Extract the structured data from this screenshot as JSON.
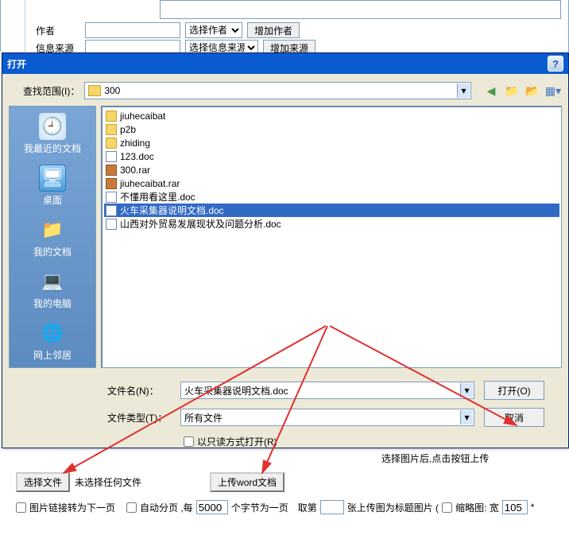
{
  "top_form": {
    "author_label": "作者",
    "author_select": "选择作者",
    "add_author_btn": "增加作者",
    "source_label": "信息来源",
    "source_select": "选择信息来源",
    "add_source_btn": "增加来源"
  },
  "dialog": {
    "title": "打开",
    "lookin_label": "查找范围(I)：",
    "lookin_value": "300",
    "sidebar": {
      "recent": "我最近的文档",
      "desktop": "桌面",
      "mydocs": "我的文档",
      "computer": "我的电脑",
      "network": "网上邻居"
    },
    "files": [
      {
        "type": "folder",
        "name": "jiuhecaibat"
      },
      {
        "type": "folder",
        "name": "p2b"
      },
      {
        "type": "folder",
        "name": "zhiding"
      },
      {
        "type": "doc",
        "name": "123.doc"
      },
      {
        "type": "rar",
        "name": "300.rar"
      },
      {
        "type": "rar",
        "name": "jiuhecaibat.rar"
      },
      {
        "type": "doc",
        "name": "不懂用看这里.doc"
      },
      {
        "type": "doc",
        "name": "火车采集器说明文档.doc",
        "selected": true
      },
      {
        "type": "doc",
        "name": "山西对外贸易发展现状及问题分析.doc"
      }
    ],
    "filename_label": "文件名(N)：",
    "filename_value": "火车采集器说明文档.doc",
    "filetype_label": "文件类型(T)：",
    "filetype_value": "所有文件",
    "open_btn": "打开(O)",
    "cancel_btn": "取消",
    "readonly_label": "以只读方式打开(R)"
  },
  "bottom": {
    "hint": "选择图片后,点击按钮上传",
    "choose_file_btn": "选择文件",
    "no_file_text": "未选择任何文件",
    "upload_word_btn": "上传word文档",
    "opt_link_next": "图片链接转为下一页",
    "opt_auto_page": "自动分页 ,每",
    "bytes_value": "5000",
    "bytes_suffix": "个字节为一页",
    "take_prefix": "取第",
    "take_suffix": "张上传图为标题图片 (",
    "thumb_label": "缩略图: 宽",
    "thumb_width": "105",
    "thumb_suffix": "*"
  }
}
